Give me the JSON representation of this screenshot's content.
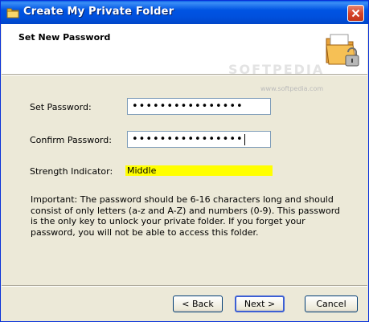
{
  "window": {
    "title": "Create My Private Folder",
    "close_icon": "close-icon",
    "app_icon": "folder-icon"
  },
  "header": {
    "title": "Set New Password",
    "icon": "folder-lock-icon",
    "watermark": "SOFTPEDIA",
    "watermark_url": "www.softpedia.com"
  },
  "form": {
    "set_password_label": "Set Password:",
    "set_password_value": "••••••••••••••••",
    "confirm_password_label": "Confirm Password:",
    "confirm_password_value": "••••••••••••••••",
    "strength_label": "Strength Indicator:",
    "strength_value": "Middle",
    "strength_color": "#ffff00"
  },
  "important_text": "Important: The password should be 6-16 characters long and should consist of only letters (a-z and A-Z) and numbers (0-9). This password is the only key to unlock your private folder. If you forget your password, you will not be able to access this folder.",
  "buttons": {
    "back": "< Back",
    "next": "Next >",
    "cancel": "Cancel"
  },
  "colors": {
    "titlebar": "#0054e3",
    "dialog_bg": "#ece9d8"
  }
}
